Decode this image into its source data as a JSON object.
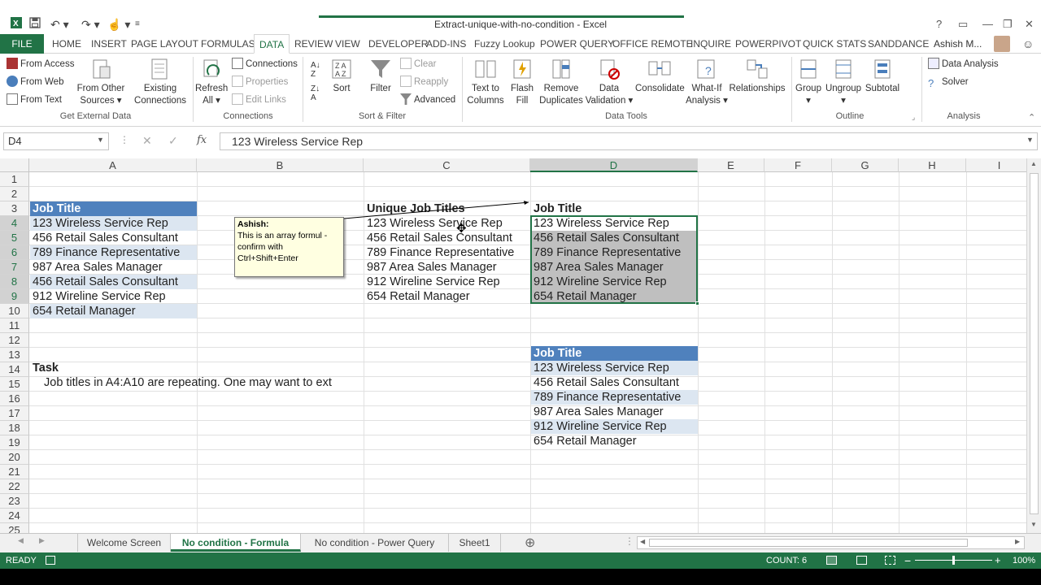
{
  "window": {
    "title": "Extract-unique-with-no-condition - Excel",
    "help": "?",
    "user": "Ashish M..."
  },
  "tabs": [
    "FILE",
    "HOME",
    "INSERT",
    "PAGE LAYOUT",
    "FORMULAS",
    "DATA",
    "REVIEW",
    "VIEW",
    "DEVELOPER",
    "ADD-INS",
    "Fuzzy Lookup",
    "POWER QUERY",
    "OFFICE REMOTE",
    "INQUIRE",
    "POWERPIVOT",
    "QUICK STATS",
    "SANDDANCE"
  ],
  "ribbon": {
    "get_external": {
      "from_access": "From Access",
      "from_web": "From Web",
      "from_text": "From Text",
      "from_other_1": "From Other",
      "from_other_2": "Sources",
      "existing_1": "Existing",
      "existing_2": "Connections",
      "group": "Get External Data"
    },
    "connections": {
      "refresh_1": "Refresh",
      "refresh_2": "All",
      "connections": "Connections",
      "properties": "Properties",
      "edit_links": "Edit Links",
      "group": "Connections"
    },
    "sort_filter": {
      "sort": "Sort",
      "filter": "Filter",
      "clear": "Clear",
      "reapply": "Reapply",
      "advanced": "Advanced",
      "group": "Sort & Filter"
    },
    "data_tools": {
      "t2c_1": "Text to",
      "t2c_2": "Columns",
      "flash_1": "Flash",
      "flash_2": "Fill",
      "remove_1": "Remove",
      "remove_2": "Duplicates",
      "valid_1": "Data",
      "valid_2": "Validation",
      "consolidate": "Consolidate",
      "whatif_1": "What-If",
      "whatif_2": "Analysis",
      "relationships": "Relationships",
      "group": "Data Tools"
    },
    "outline": {
      "group_btn": "Group",
      "ungroup": "Ungroup",
      "subtotal": "Subtotal",
      "group": "Outline"
    },
    "analysis": {
      "data_analysis": "Data Analysis",
      "solver": "Solver",
      "group": "Analysis"
    }
  },
  "formula_bar": {
    "name_box": "D4",
    "formula": "123 Wireless Service Rep"
  },
  "columns": [
    "A",
    "B",
    "C",
    "D",
    "E",
    "F",
    "G",
    "H",
    "I"
  ],
  "rows": [
    "1",
    "2",
    "3",
    "4",
    "5",
    "6",
    "7",
    "8",
    "9",
    "10",
    "11",
    "12",
    "13",
    "14",
    "15",
    "16",
    "17",
    "18",
    "19",
    "20",
    "21",
    "22",
    "23",
    "24",
    "25"
  ],
  "sheet": {
    "a3": "Job Title",
    "col_a": [
      "123 Wireless Service Rep",
      "456 Retail Sales Consultant",
      "789 Finance Representative",
      "987 Area Sales Manager",
      "456 Retail Sales Consultant",
      "912 Wireline Service Rep",
      "654 Retail Manager"
    ],
    "c3": "Unique Job Titles",
    "col_c": [
      "123 Wireless Service Rep",
      "456 Retail Sales Consultant",
      "789 Finance Representative",
      "987 Area Sales Manager",
      "912 Wireline Service Rep",
      "654 Retail Manager"
    ],
    "d3": "Job Title",
    "col_d": [
      "123 Wireless Service Rep",
      "456 Retail Sales Consultant",
      "789 Finance Representative",
      "987 Area Sales Manager",
      "912 Wireline Service Rep",
      "654 Retail Manager"
    ],
    "d13": "Job Title",
    "col_d2": [
      "123 Wireless Service Rep",
      "456 Retail Sales Consultant",
      "789 Finance Representative",
      "987 Area Sales Manager",
      "912 Wireline Service Rep",
      "654 Retail Manager"
    ],
    "a14": "Task",
    "a15": "Job titles in A4:A10 are repeating.  One may want to ext"
  },
  "comment": {
    "author": "Ashish:",
    "text": "This is an array formul - confirm with Ctrl+Shift+Enter"
  },
  "sheet_tabs": [
    "Welcome Screen",
    "No condition - Formula",
    "No condition - Power Query",
    "Sheet1"
  ],
  "status": {
    "ready": "READY",
    "count": "COUNT: 6",
    "zoom": "100%"
  },
  "colors": {
    "excel_green": "#217346",
    "table_header": "#4f81bd",
    "band": "#dce6f1"
  }
}
